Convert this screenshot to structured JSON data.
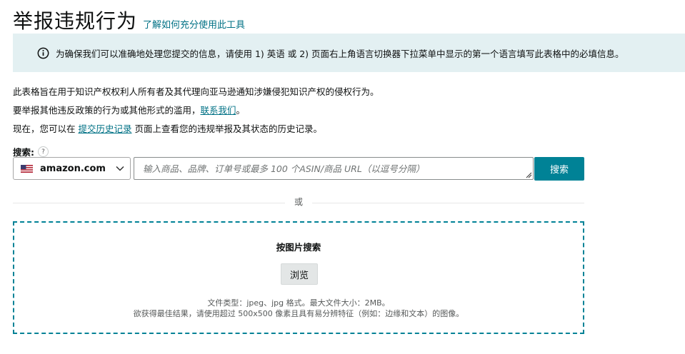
{
  "header": {
    "title": "举报违规行为",
    "help_link": "了解如何充分使用此工具"
  },
  "info_banner": {
    "icon": "info-icon",
    "text": "为确保我们可以准确地处理您提交的信息，请使用 1) 英语 或 2) 页面右上角语言切换器下拉菜单中显示的第一个语言填写此表格中的必填信息。"
  },
  "description": {
    "line1": "此表格旨在用于知识产权权利人所有者及其代理向亚马逊通知涉嫌侵犯知识产权的侵权行为。",
    "line2_prefix": "要举报其他违反政策的行为或其他形式的滥用，",
    "line2_link": "联系我们",
    "line2_suffix": "。",
    "line3_prefix": "现在，您可以在 ",
    "line3_link": "提交历史记录",
    "line3_suffix": " 页面上查看您的违规举报及其状态的历史记录。"
  },
  "search": {
    "label": "搜索:",
    "help": "?",
    "marketplace": "amazon.com",
    "marketplace_flag": "us-flag-icon",
    "placeholder": "输入商品、品牌、订单号或最多 100 个ASIN/商品 URL（以逗号分隔）",
    "button": "搜索"
  },
  "divider_text": "或",
  "image_search": {
    "title": "按图片搜索",
    "browse": "浏览",
    "note1": "文件类型：jpeg、jpg 格式。最大文件大小：2MB。",
    "note2": "欲获得最佳结果，请使用超过 500x500 像素且具有易分辨特征（例如：边缘和文本）的图像。"
  },
  "colors": {
    "accent": "#008296",
    "link": "#007185",
    "banner_bg": "#e3f0f2"
  }
}
